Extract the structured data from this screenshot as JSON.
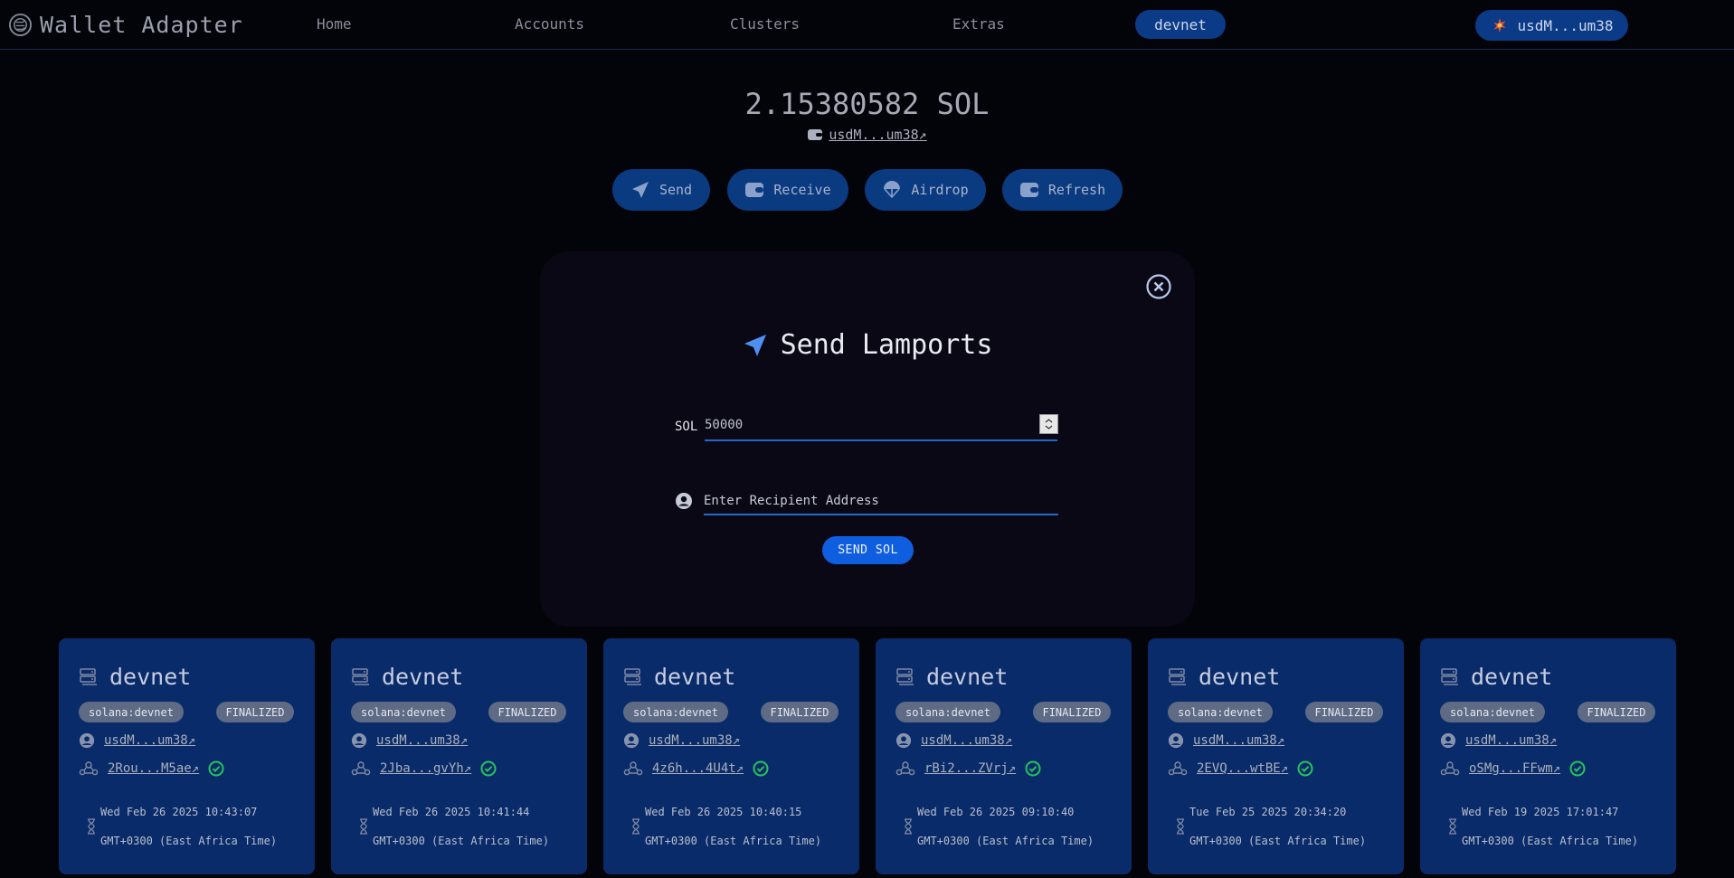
{
  "header": {
    "app_title": "Wallet Adapter",
    "nav": [
      "Home",
      "Accounts",
      "Clusters",
      "Extras"
    ],
    "cluster": "devnet",
    "wallet_label": "usdM...um38"
  },
  "account": {
    "balance": "2.15380582 SOL",
    "address": "usdM...um38",
    "actions": [
      "Send",
      "Receive",
      "Airdrop",
      "Refresh"
    ]
  },
  "modal": {
    "title": "Send Lamports",
    "amount_label": "SOL",
    "amount_value": "50000",
    "recipient_placeholder": "Enter Recipient Address",
    "submit_label": "SEND SOL"
  },
  "transactions": [
    {
      "cluster": "devnet",
      "network": "solana:devnet",
      "status": "FINALIZED",
      "account": "usdM...um38",
      "signature": "2Rou...M5ae",
      "date": "Wed Feb 26 2025 10:43:07",
      "tz": "GMT+0300 (East Africa Time)"
    },
    {
      "cluster": "devnet",
      "network": "solana:devnet",
      "status": "FINALIZED",
      "account": "usdM...um38",
      "signature": "2Jba...gvYh",
      "date": "Wed Feb 26 2025 10:41:44",
      "tz": "GMT+0300 (East Africa Time)"
    },
    {
      "cluster": "devnet",
      "network": "solana:devnet",
      "status": "FINALIZED",
      "account": "usdM...um38",
      "signature": "4z6h...4U4t",
      "date": "Wed Feb 26 2025 10:40:15",
      "tz": "GMT+0300 (East Africa Time)"
    },
    {
      "cluster": "devnet",
      "network": "solana:devnet",
      "status": "FINALIZED",
      "account": "usdM...um38",
      "signature": "rBi2...ZVrj",
      "date": "Wed Feb 26 2025 09:10:40",
      "tz": "GMT+0300 (East Africa Time)"
    },
    {
      "cluster": "devnet",
      "network": "solana:devnet",
      "status": "FINALIZED",
      "account": "usdM...um38",
      "signature": "2EVQ...wtBE",
      "date": "Tue Feb 25 2025 20:34:20",
      "tz": "GMT+0300 (East Africa Time)"
    },
    {
      "cluster": "devnet",
      "network": "solana:devnet",
      "status": "FINALIZED",
      "account": "usdM...um38",
      "signature": "oSMg...FFwm",
      "date": "Wed Feb 19 2025 17:01:47",
      "tz": "GMT+0300 (East Africa Time)"
    }
  ],
  "link_suffix": "↗",
  "colors": {
    "accent": "#0f5ee0",
    "card_bg": "#0a2b69",
    "modal_bg": "#0a0814",
    "success": "#22c55e"
  },
  "icons": {
    "logo": "solana-logo-icon",
    "send": "paper-plane-icon",
    "receive": "wallet-icon",
    "airdrop": "parachute-icon",
    "refresh": "wallet-refresh-icon",
    "close": "close-circle-icon",
    "user": "user-circle-icon",
    "server": "server-icon",
    "tx": "network-icon",
    "check": "check-circle-icon"
  }
}
